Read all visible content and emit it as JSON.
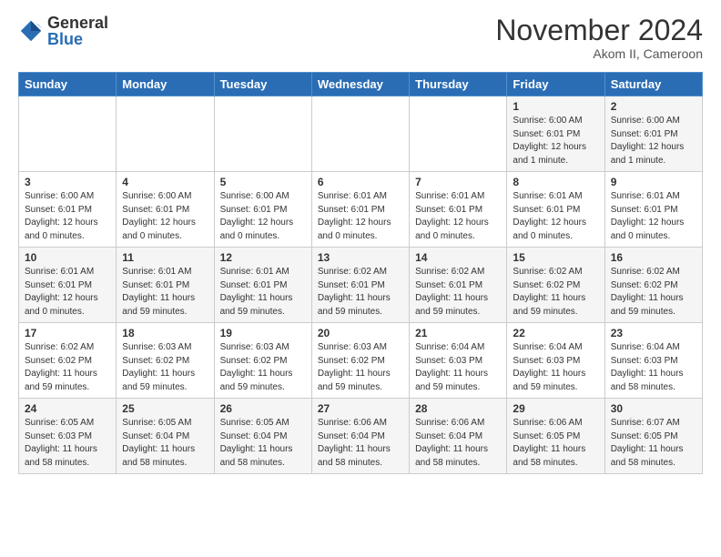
{
  "header": {
    "logo_general": "General",
    "logo_blue": "Blue",
    "month_title": "November 2024",
    "location": "Akom II, Cameroon"
  },
  "weekdays": [
    "Sunday",
    "Monday",
    "Tuesday",
    "Wednesday",
    "Thursday",
    "Friday",
    "Saturday"
  ],
  "weeks": [
    [
      {
        "day": "",
        "info": ""
      },
      {
        "day": "",
        "info": ""
      },
      {
        "day": "",
        "info": ""
      },
      {
        "day": "",
        "info": ""
      },
      {
        "day": "",
        "info": ""
      },
      {
        "day": "1",
        "info": "Sunrise: 6:00 AM\nSunset: 6:01 PM\nDaylight: 12 hours\nand 1 minute."
      },
      {
        "day": "2",
        "info": "Sunrise: 6:00 AM\nSunset: 6:01 PM\nDaylight: 12 hours\nand 1 minute."
      }
    ],
    [
      {
        "day": "3",
        "info": "Sunrise: 6:00 AM\nSunset: 6:01 PM\nDaylight: 12 hours\nand 0 minutes."
      },
      {
        "day": "4",
        "info": "Sunrise: 6:00 AM\nSunset: 6:01 PM\nDaylight: 12 hours\nand 0 minutes."
      },
      {
        "day": "5",
        "info": "Sunrise: 6:00 AM\nSunset: 6:01 PM\nDaylight: 12 hours\nand 0 minutes."
      },
      {
        "day": "6",
        "info": "Sunrise: 6:01 AM\nSunset: 6:01 PM\nDaylight: 12 hours\nand 0 minutes."
      },
      {
        "day": "7",
        "info": "Sunrise: 6:01 AM\nSunset: 6:01 PM\nDaylight: 12 hours\nand 0 minutes."
      },
      {
        "day": "8",
        "info": "Sunrise: 6:01 AM\nSunset: 6:01 PM\nDaylight: 12 hours\nand 0 minutes."
      },
      {
        "day": "9",
        "info": "Sunrise: 6:01 AM\nSunset: 6:01 PM\nDaylight: 12 hours\nand 0 minutes."
      }
    ],
    [
      {
        "day": "10",
        "info": "Sunrise: 6:01 AM\nSunset: 6:01 PM\nDaylight: 12 hours\nand 0 minutes."
      },
      {
        "day": "11",
        "info": "Sunrise: 6:01 AM\nSunset: 6:01 PM\nDaylight: 11 hours\nand 59 minutes."
      },
      {
        "day": "12",
        "info": "Sunrise: 6:01 AM\nSunset: 6:01 PM\nDaylight: 11 hours\nand 59 minutes."
      },
      {
        "day": "13",
        "info": "Sunrise: 6:02 AM\nSunset: 6:01 PM\nDaylight: 11 hours\nand 59 minutes."
      },
      {
        "day": "14",
        "info": "Sunrise: 6:02 AM\nSunset: 6:01 PM\nDaylight: 11 hours\nand 59 minutes."
      },
      {
        "day": "15",
        "info": "Sunrise: 6:02 AM\nSunset: 6:02 PM\nDaylight: 11 hours\nand 59 minutes."
      },
      {
        "day": "16",
        "info": "Sunrise: 6:02 AM\nSunset: 6:02 PM\nDaylight: 11 hours\nand 59 minutes."
      }
    ],
    [
      {
        "day": "17",
        "info": "Sunrise: 6:02 AM\nSunset: 6:02 PM\nDaylight: 11 hours\nand 59 minutes."
      },
      {
        "day": "18",
        "info": "Sunrise: 6:03 AM\nSunset: 6:02 PM\nDaylight: 11 hours\nand 59 minutes."
      },
      {
        "day": "19",
        "info": "Sunrise: 6:03 AM\nSunset: 6:02 PM\nDaylight: 11 hours\nand 59 minutes."
      },
      {
        "day": "20",
        "info": "Sunrise: 6:03 AM\nSunset: 6:02 PM\nDaylight: 11 hours\nand 59 minutes."
      },
      {
        "day": "21",
        "info": "Sunrise: 6:04 AM\nSunset: 6:03 PM\nDaylight: 11 hours\nand 59 minutes."
      },
      {
        "day": "22",
        "info": "Sunrise: 6:04 AM\nSunset: 6:03 PM\nDaylight: 11 hours\nand 59 minutes."
      },
      {
        "day": "23",
        "info": "Sunrise: 6:04 AM\nSunset: 6:03 PM\nDaylight: 11 hours\nand 58 minutes."
      }
    ],
    [
      {
        "day": "24",
        "info": "Sunrise: 6:05 AM\nSunset: 6:03 PM\nDaylight: 11 hours\nand 58 minutes."
      },
      {
        "day": "25",
        "info": "Sunrise: 6:05 AM\nSunset: 6:04 PM\nDaylight: 11 hours\nand 58 minutes."
      },
      {
        "day": "26",
        "info": "Sunrise: 6:05 AM\nSunset: 6:04 PM\nDaylight: 11 hours\nand 58 minutes."
      },
      {
        "day": "27",
        "info": "Sunrise: 6:06 AM\nSunset: 6:04 PM\nDaylight: 11 hours\nand 58 minutes."
      },
      {
        "day": "28",
        "info": "Sunrise: 6:06 AM\nSunset: 6:04 PM\nDaylight: 11 hours\nand 58 minutes."
      },
      {
        "day": "29",
        "info": "Sunrise: 6:06 AM\nSunset: 6:05 PM\nDaylight: 11 hours\nand 58 minutes."
      },
      {
        "day": "30",
        "info": "Sunrise: 6:07 AM\nSunset: 6:05 PM\nDaylight: 11 hours\nand 58 minutes."
      }
    ]
  ]
}
